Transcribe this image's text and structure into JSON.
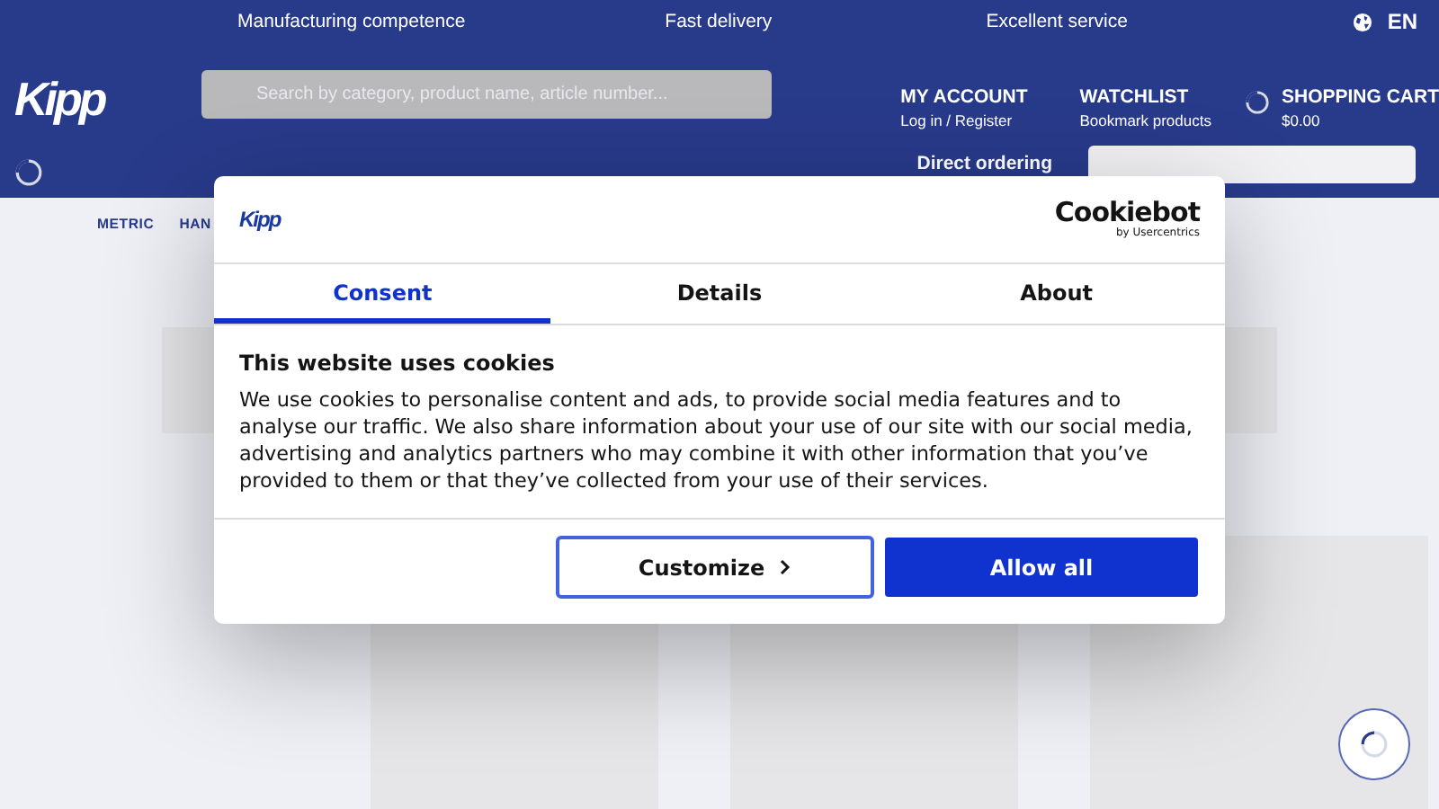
{
  "topbar": {
    "usps": [
      "Manufacturing competence",
      "Fast delivery",
      "Excellent service"
    ],
    "language": "EN"
  },
  "header": {
    "logo": "Kipp",
    "search": {
      "placeholder": "Search by category, product name, article number..."
    },
    "links": [
      {
        "title": "MY ACCOUNT",
        "subtitle": "Log in / Register",
        "kind": "plain"
      },
      {
        "title": "WATCHLIST",
        "subtitle": "Bookmark products",
        "kind": "plain"
      },
      {
        "title": "SHOPPING CART",
        "subtitle": "$0.00",
        "kind": "cart"
      }
    ],
    "direct_ordering": {
      "label": "Direct ordering"
    }
  },
  "nav": {
    "items": [
      "METRIC",
      "HAN"
    ]
  },
  "dialog": {
    "logo": "Kipp",
    "brand": {
      "name": "Cookiebot",
      "byline": "by Usercentrics"
    },
    "tabs": [
      {
        "label": "Consent",
        "selected": true
      },
      {
        "label": "Details",
        "selected": false
      },
      {
        "label": "About",
        "selected": false
      }
    ],
    "title": "This website uses cookies",
    "text": "We use cookies to personalise content and ads, to provide social media features and to analyse our traffic. We also share information about your use of our site with our social media, advertising and analytics partners who may combine it with other information that you’ve provided to them or that they’ve collected from your use of their services.",
    "buttons": [
      {
        "label": "Customize",
        "kind": "outline"
      },
      {
        "label": "Allow all",
        "kind": "primary"
      }
    ]
  }
}
